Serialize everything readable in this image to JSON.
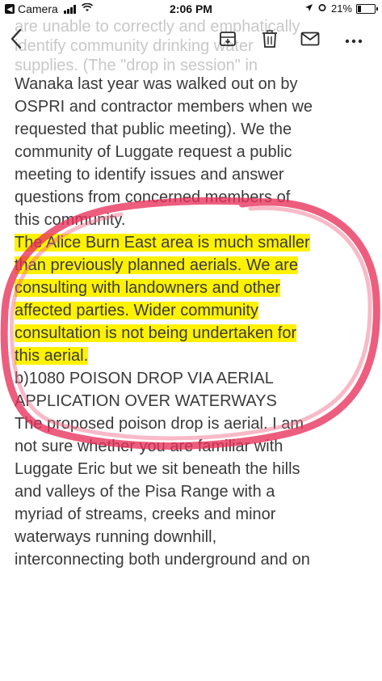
{
  "status_bar": {
    "back_app": "Camera",
    "time": "2:06 PM",
    "battery": "21%"
  },
  "ghost_text": {
    "line1": "are unable to correctly and emphatically",
    "line2": "identify community drinking water",
    "line3": "supplies. (The \"drop in session\" in"
  },
  "body": {
    "para1_lines": [
      "Wanaka last year was walked out on by",
      "OSPRI and contractor members when we",
      "requested that public meeting).  We the",
      "community of Luggate request a public",
      "meeting to identify issues and answer",
      "questions from concerned members of",
      "this community."
    ],
    "highlight_lines": [
      "The Alice Burn East area is much smaller",
      "than previously planned aerials. We are",
      "consulting with landowners and other",
      "affected parties. Wider community",
      "consultation is not being undertaken for",
      "this aerial."
    ],
    "heading_lines": [
      "b)1080 POISON DROP VIA AERIAL",
      "APPLICATION OVER WATERWAYS"
    ],
    "para3_lines": [
      "The proposed poison drop is aerial. I am",
      "not sure whether you are familiar with",
      "Luggate Eric but we sit beneath the hills",
      "and valleys of the Pisa Range with a",
      "myriad of streams, creeks and minor",
      "waterways running downhill,",
      "interconnecting both underground and on"
    ]
  },
  "colors": {
    "highlight": "#fff200",
    "annotation_loop": "#e8315a"
  },
  "icons": {
    "back": "chevron-left-icon",
    "archive": "archive-tray-icon",
    "trash": "trash-icon",
    "mail": "envelope-icon",
    "more": "ellipsis-icon"
  }
}
